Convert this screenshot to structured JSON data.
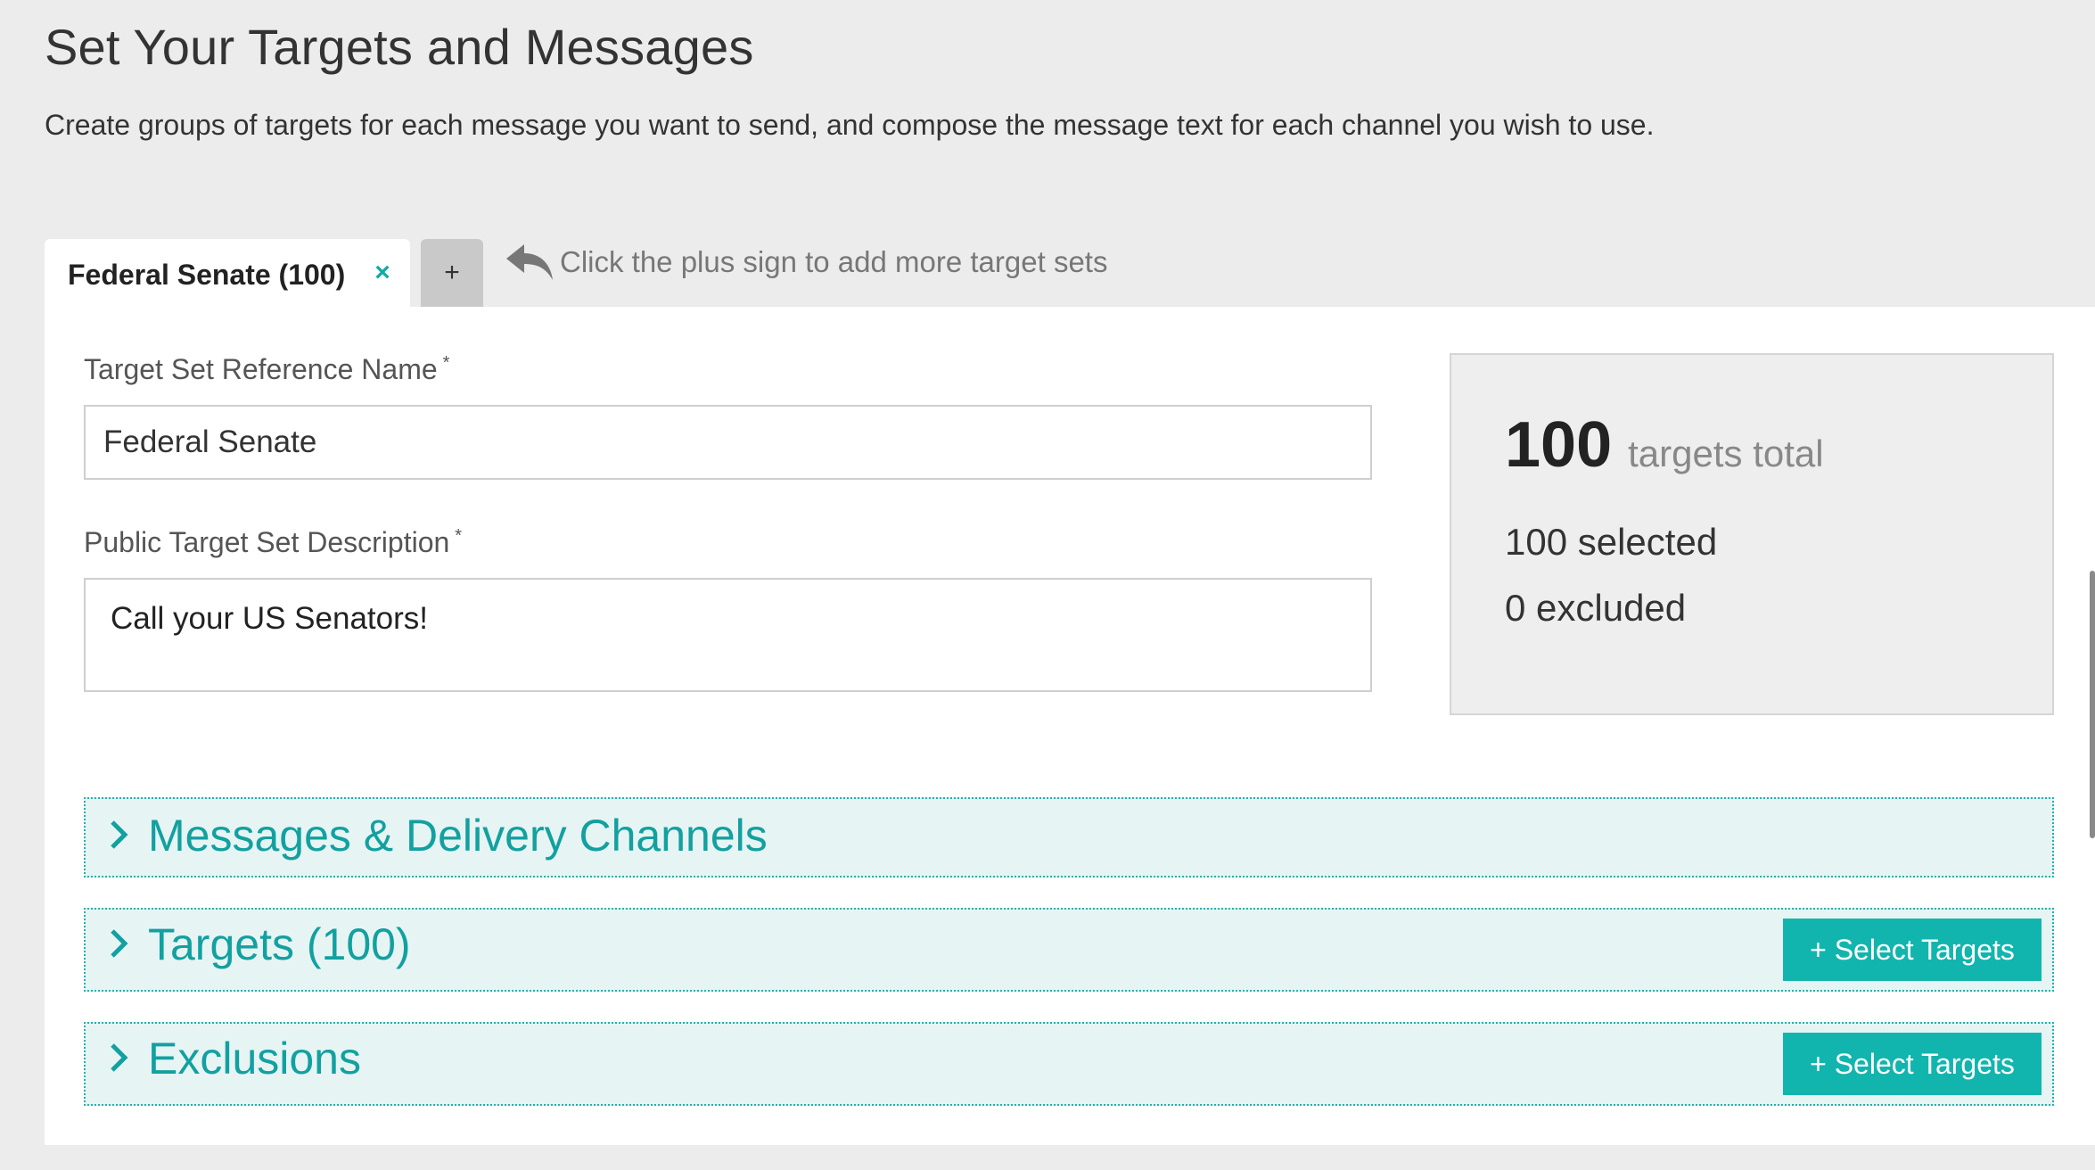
{
  "header": {
    "title": "Set Your Targets and Messages",
    "subtitle": "Create groups of targets for each message you want to send, and compose the message text for each channel you wish to use."
  },
  "tabs": {
    "active_label": "Federal Senate (100)",
    "close_symbol": "×",
    "add_symbol": "+",
    "hint": "Click the plus sign to add more target sets"
  },
  "form": {
    "reference_name_label": "Target Set Reference Name",
    "reference_name_value": "Federal Senate",
    "description_label": "Public Target Set Description",
    "description_value": "Call your US Senators!",
    "required_mark": "*"
  },
  "summary": {
    "total_count": "100",
    "total_label": "targets total",
    "selected": "100 selected",
    "excluded": "0 excluded"
  },
  "sections": {
    "messages_title": "Messages & Delivery Channels",
    "targets_title": "Targets (100)",
    "exclusions_title": "Exclusions",
    "select_targets_label": "+ Select Targets"
  },
  "colors": {
    "accent": "#12b5ae",
    "section_bg": "#e6f5f4",
    "page_bg": "#ececec"
  },
  "icons": {
    "hint_arrow": "reply-arrow-icon",
    "chevron": "chevron-right-icon",
    "close": "close-icon",
    "add": "plus-icon"
  }
}
